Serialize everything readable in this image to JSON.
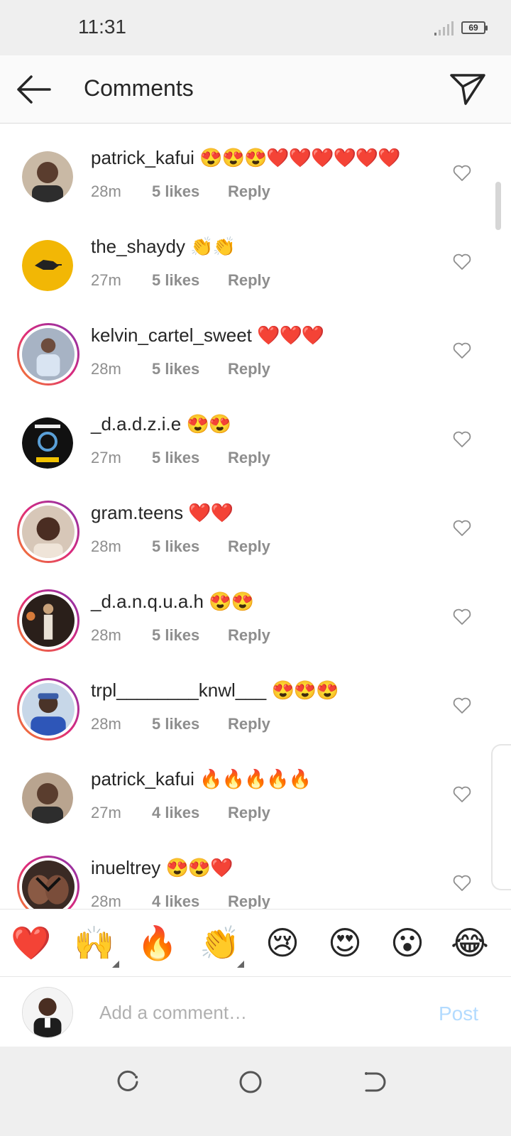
{
  "status": {
    "time": "11:31",
    "battery": "69"
  },
  "header": {
    "title": "Comments"
  },
  "comments": [
    {
      "username": "patrick_kafui",
      "text": "😍😍😍❤️❤️❤️❤️❤️❤️",
      "time": "28m",
      "likes": "5 likes",
      "reply": "Reply"
    },
    {
      "username": "the_shaydy",
      "text": "👏👏",
      "time": "27m",
      "likes": "5 likes",
      "reply": "Reply"
    },
    {
      "username": "kelvin_cartel_sweet",
      "text": "❤️❤️❤️",
      "time": "28m",
      "likes": "5 likes",
      "reply": "Reply"
    },
    {
      "username": "_d.a.d.z.i.e",
      "text": "😍😍",
      "time": "27m",
      "likes": "5 likes",
      "reply": "Reply"
    },
    {
      "username": "gram.teens",
      "text": "❤️❤️",
      "time": "28m",
      "likes": "5 likes",
      "reply": "Reply"
    },
    {
      "username": "_d.a.n.q.u.a.h",
      "text": "😍😍",
      "time": "28m",
      "likes": "5 likes",
      "reply": "Reply"
    },
    {
      "username": "trpl________knwl___",
      "text": "😍😍😍",
      "time": "28m",
      "likes": "5 likes",
      "reply": "Reply"
    },
    {
      "username": "patrick_kafui",
      "text": "🔥🔥🔥🔥🔥",
      "time": "27m",
      "likes": "4 likes",
      "reply": "Reply"
    },
    {
      "username": "inueltrey",
      "text": "😍😍❤️",
      "time": "28m",
      "likes": "4 likes",
      "reply": "Reply"
    }
  ],
  "quick_reactions": [
    "❤️",
    "🙌",
    "🔥",
    "👏",
    "😢",
    "😍",
    "😮",
    "😂"
  ],
  "composer": {
    "placeholder": "Add a comment…",
    "post_label": "Post"
  },
  "colors": {
    "accent_disabled": "#b3dbff",
    "text_secondary": "#8e8e8e",
    "story_ring_start": "#f58529",
    "story_ring_end": "#8134af"
  }
}
